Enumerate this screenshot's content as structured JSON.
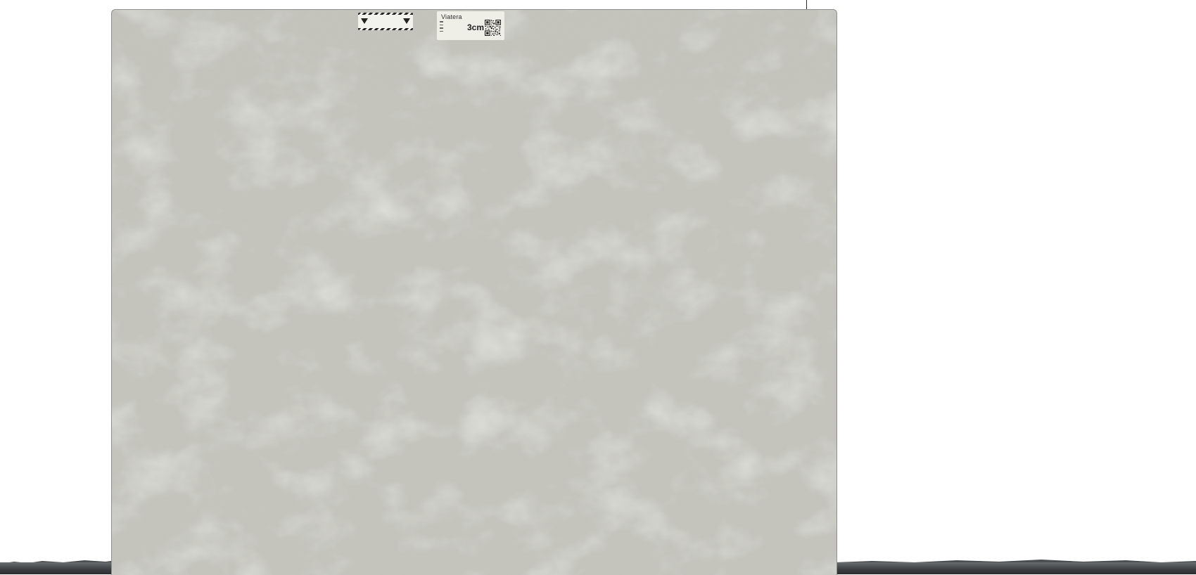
{
  "scene": {
    "subject": "stone-slab",
    "background_color": "#ffffff",
    "slab_color": "#c3c3bc"
  },
  "caution_sticker": {
    "text_left": "",
    "text_right": ""
  },
  "product_label": {
    "brand": "Viatera",
    "thickness": "3cm",
    "code": ""
  },
  "icons": [
    "qr-code-icon",
    "warning-triangle-icon"
  ]
}
